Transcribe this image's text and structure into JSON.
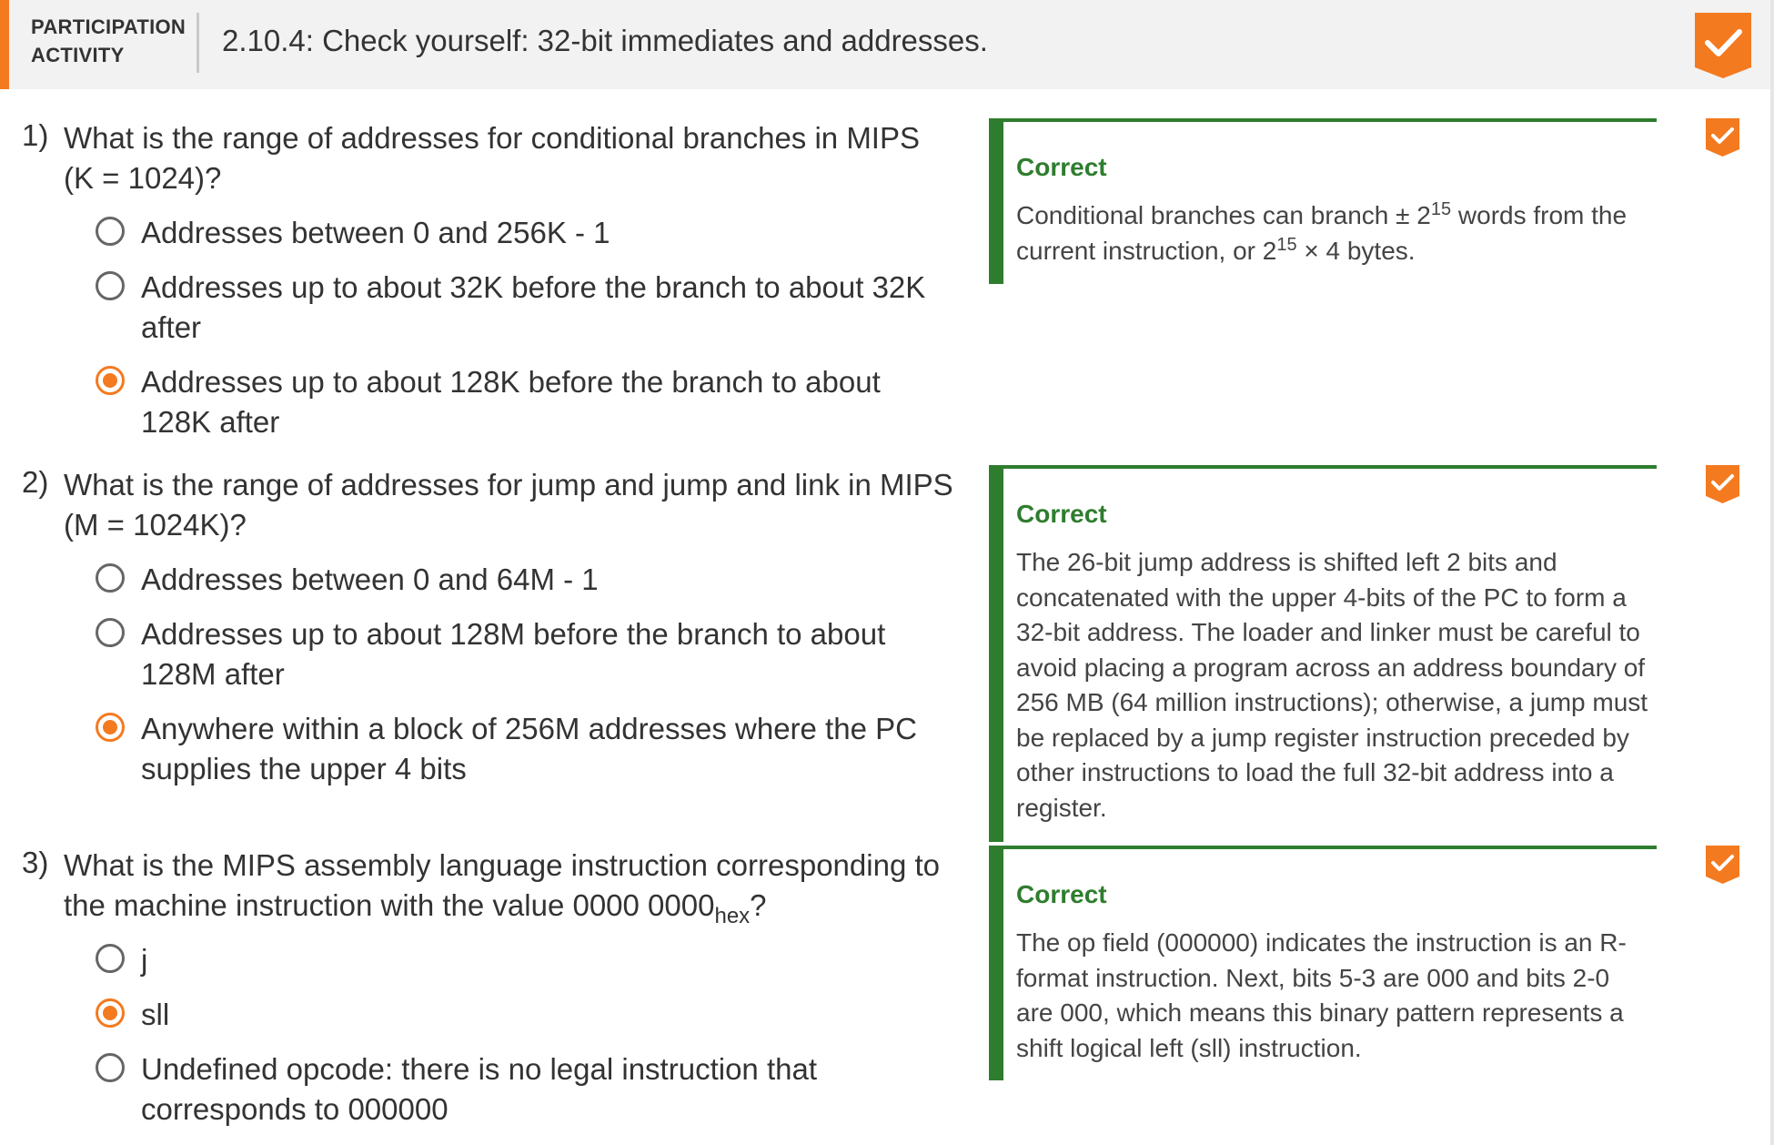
{
  "header": {
    "label_line1": "PARTICIPATION",
    "label_line2": "ACTIVITY",
    "title": "2.10.4: Check yourself: 32-bit immediates and addresses.",
    "status_icon": "check-ribbon-icon",
    "accent_color": "#f47a1f"
  },
  "questions": [
    {
      "number": "1)",
      "text": "What is the range of addresses for conditional branches in MIPS (K = 1024)?",
      "choices": [
        {
          "label": "Addresses between 0 and 256K - 1",
          "selected": false
        },
        {
          "label": "Addresses up to about 32K before the branch to about 32K after",
          "selected": false
        },
        {
          "label": "Addresses up to about 128K before the branch to about 128K after",
          "selected": true
        }
      ],
      "feedback": {
        "status": "Correct",
        "text_part1": "Conditional branches can branch ± 2",
        "text_sup1": "15",
        "text_part2": " words from the current instruction, or 2",
        "text_sup2": "15",
        "text_part3": " × 4 bytes."
      }
    },
    {
      "number": "2)",
      "text": "What is the range of addresses for jump and jump and link in MIPS (M = 1024K)?",
      "choices": [
        {
          "label": "Addresses between 0 and 64M - 1",
          "selected": false
        },
        {
          "label": "Addresses up to about 128M before the branch to about 128M after",
          "selected": false
        },
        {
          "label": "Anywhere within a block of 256M addresses where the PC supplies the upper 4 bits",
          "selected": true
        }
      ],
      "feedback": {
        "status": "Correct",
        "text": "The 26-bit jump address is shifted left 2 bits and concatenated with the upper 4-bits of the PC to form a 32-bit address. The loader and linker must be careful to avoid placing a program across an address boundary of 256 MB (64 million instructions); otherwise, a jump must be replaced by a jump register instruction preceded by other instructions to load the full 32-bit address into a register."
      }
    },
    {
      "number": "3)",
      "text_main": "What is the MIPS assembly language instruction corresponding to the machine instruction with the value 0000 0000",
      "text_sub": "hex",
      "text_end": "?",
      "choices": [
        {
          "label": "j",
          "selected": false
        },
        {
          "label": "sll",
          "selected": true
        },
        {
          "label": "Undefined opcode: there is no legal instruction that corresponds to 000000",
          "selected": false
        }
      ],
      "feedback": {
        "status": "Correct",
        "text": "The op field (000000) indicates the instruction is an R-format instruction. Next, bits 5-3 are 000 and bits 2-0 are 000, which means this binary pattern represents a shift logical left (sll) instruction."
      }
    }
  ],
  "colors": {
    "correct_green": "#2e7d2e",
    "selected_orange": "#f47a1f"
  }
}
